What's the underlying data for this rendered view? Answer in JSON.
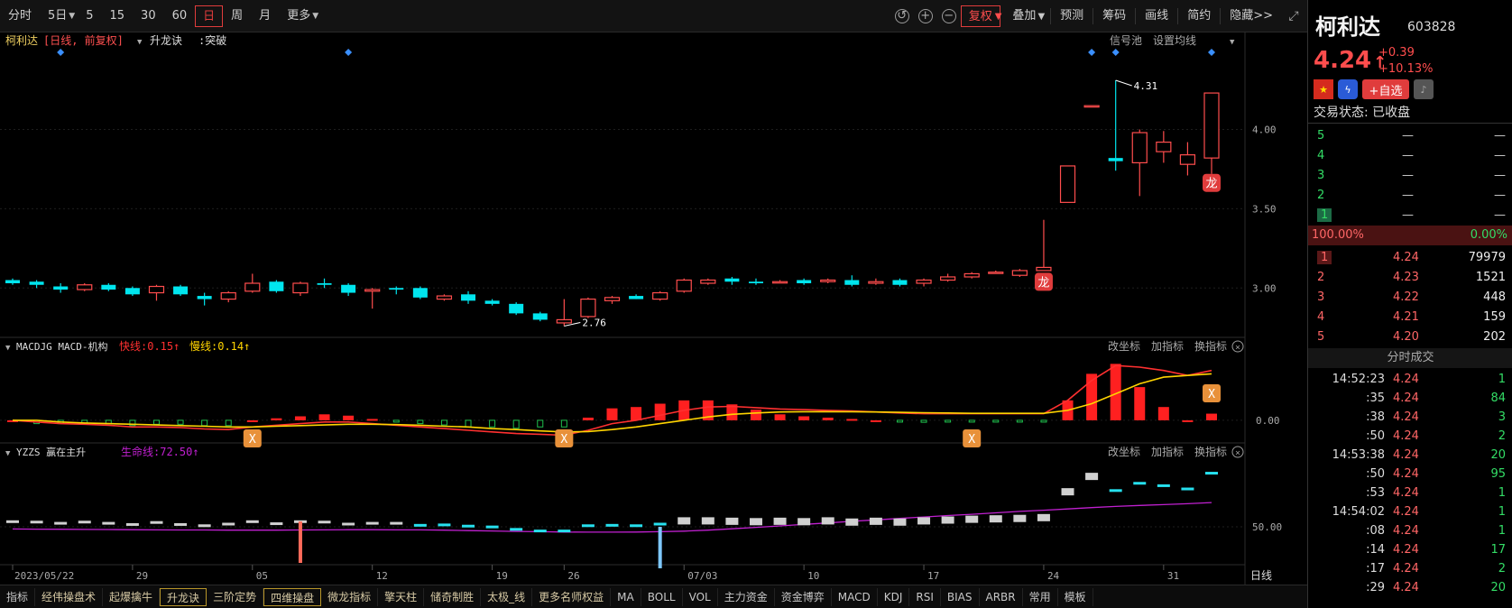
{
  "toolbar": {
    "left": [
      "分时",
      "5日",
      "5",
      "15",
      "30",
      "60",
      "日",
      "周",
      "月",
      "更多"
    ],
    "active_index": 6,
    "right": [
      "复权",
      "叠加",
      "预测",
      "筹码",
      "画线",
      "简约",
      "隐藏>>"
    ]
  },
  "stock": {
    "name": "柯利达",
    "code": "603828",
    "price": "4.24",
    "arrow": "↑",
    "change": "+0.39",
    "change_pct": "+10.13%",
    "trade_status": "交易状态: 已收盘",
    "add_fav": "+自选"
  },
  "main_panel": {
    "stock_label": "柯利达",
    "period_label": "[日线, 前复权]",
    "indicator": "升龙诀",
    "indicator_value": ":突破",
    "right_labels": [
      "信号池",
      "设置均线"
    ],
    "max_label": "4.31",
    "min_label": "2.76",
    "badge": "龙"
  },
  "macd_panel": {
    "name": "MACDJG MACD-机构",
    "fast_label": "快线:0.15↑",
    "slow_label": "慢线:0.14↑",
    "actions": [
      "改坐标",
      "加指标",
      "换指标"
    ],
    "badge": "X"
  },
  "yzzs_panel": {
    "name": "YZZS 赢在主升",
    "line_label": "生命线:72.50↑",
    "actions": [
      "改坐标",
      "加指标",
      "换指标"
    ]
  },
  "x_axis": {
    "labels": [
      "2023/05/22",
      "29",
      "05",
      "12",
      "19",
      "26",
      "07/03",
      "10",
      "17",
      "24",
      "31"
    ],
    "period": "日线"
  },
  "y_axis": {
    "main": [
      "4.00",
      "3.50",
      "3.00"
    ],
    "macd": [
      "0.00"
    ],
    "yzzs": [
      "50.00"
    ]
  },
  "bottom_tabs": [
    "指标",
    "经伟操盘术",
    "起爆擒牛",
    "升龙诀",
    "三阶定势",
    "四维操盘",
    "微龙指标",
    "擎天柱",
    "储奇制胜",
    "太极_线",
    "更多名师权益",
    "MA",
    "BOLL",
    "VOL",
    "主力资金",
    "资金博弈",
    "MACD",
    "KDJ",
    "RSI",
    "BIAS",
    "ARBR",
    "常用",
    "模板"
  ],
  "order_book": {
    "asks": [
      {
        "level": "5",
        "price": "—",
        "vol": "—"
      },
      {
        "level": "4",
        "price": "—",
        "vol": "—"
      },
      {
        "level": "3",
        "price": "—",
        "vol": "—"
      },
      {
        "level": "2",
        "price": "—",
        "vol": "—"
      },
      {
        "level": "1",
        "price": "—",
        "vol": "—"
      }
    ],
    "ratio_left": "100.00%",
    "ratio_right": "0.00%",
    "bids": [
      {
        "level": "1",
        "price": "4.24",
        "vol": "79979"
      },
      {
        "level": "2",
        "price": "4.23",
        "vol": "1521"
      },
      {
        "level": "3",
        "price": "4.22",
        "vol": "448"
      },
      {
        "level": "4",
        "price": "4.21",
        "vol": "159"
      },
      {
        "level": "5",
        "price": "4.20",
        "vol": "202"
      }
    ]
  },
  "ticks": {
    "title": "分时成交",
    "rows": [
      {
        "time": "14:52:23",
        "price": "4.24",
        "vol": "1"
      },
      {
        "time": ":35",
        "price": "4.24",
        "vol": "84"
      },
      {
        "time": ":38",
        "price": "4.24",
        "vol": "3"
      },
      {
        "time": ":50",
        "price": "4.24",
        "vol": "2"
      },
      {
        "time": "14:53:38",
        "price": "4.24",
        "vol": "20"
      },
      {
        "time": ":50",
        "price": "4.24",
        "vol": "95"
      },
      {
        "time": ":53",
        "price": "4.24",
        "vol": "1"
      },
      {
        "time": "14:54:02",
        "price": "4.24",
        "vol": "1"
      },
      {
        "time": ":08",
        "price": "4.24",
        "vol": "1"
      },
      {
        "time": ":14",
        "price": "4.24",
        "vol": "17"
      },
      {
        "time": ":17",
        "price": "4.24",
        "vol": "2"
      },
      {
        "time": ":29",
        "price": "4.24",
        "vol": "20"
      }
    ]
  },
  "colors": {
    "up": "#ff4d4d",
    "down": "#00e5ee",
    "macd_fast": "#ff3030",
    "macd_slow": "#ffd400",
    "life_line": "#c020d0",
    "accent": "#e03c3c"
  },
  "chart_data": {
    "type": "candlestick",
    "ylim": [
      2.7,
      4.35
    ],
    "candles": [
      {
        "date": "2023-05-22",
        "o": 3.05,
        "h": 3.06,
        "l": 3.02,
        "c": 3.03
      },
      {
        "date": "2023-05-23",
        "o": 3.04,
        "h": 3.05,
        "l": 3.0,
        "c": 3.02
      },
      {
        "date": "2023-05-24",
        "o": 3.01,
        "h": 3.03,
        "l": 2.97,
        "c": 2.99
      },
      {
        "date": "2023-05-25",
        "o": 2.99,
        "h": 3.03,
        "l": 2.98,
        "c": 3.02
      },
      {
        "date": "2023-05-26",
        "o": 3.02,
        "h": 3.03,
        "l": 2.98,
        "c": 2.99
      },
      {
        "date": "2023-05-29",
        "o": 3.0,
        "h": 3.01,
        "l": 2.95,
        "c": 2.96
      },
      {
        "date": "2023-05-30",
        "o": 2.97,
        "h": 3.02,
        "l": 2.92,
        "c": 3.01
      },
      {
        "date": "2023-05-31",
        "o": 3.01,
        "h": 3.02,
        "l": 2.95,
        "c": 2.96
      },
      {
        "date": "2023-06-01",
        "o": 2.95,
        "h": 2.97,
        "l": 2.89,
        "c": 2.93
      },
      {
        "date": "2023-06-02",
        "o": 2.93,
        "h": 2.98,
        "l": 2.91,
        "c": 2.97
      },
      {
        "date": "2023-06-05",
        "o": 2.98,
        "h": 3.09,
        "l": 2.97,
        "c": 3.03
      },
      {
        "date": "2023-06-06",
        "o": 3.04,
        "h": 3.05,
        "l": 2.97,
        "c": 2.98
      },
      {
        "date": "2023-06-07",
        "o": 2.97,
        "h": 3.04,
        "l": 2.95,
        "c": 3.03
      },
      {
        "date": "2023-06-08",
        "o": 3.03,
        "h": 3.06,
        "l": 3.0,
        "c": 3.02
      },
      {
        "date": "2023-06-09",
        "o": 3.02,
        "h": 3.03,
        "l": 2.95,
        "c": 2.97
      },
      {
        "date": "2023-06-12",
        "o": 2.98,
        "h": 3.0,
        "l": 2.87,
        "c": 2.99
      },
      {
        "date": "2023-06-13",
        "o": 3.0,
        "h": 3.01,
        "l": 2.96,
        "c": 2.99
      },
      {
        "date": "2023-06-14",
        "o": 3.0,
        "h": 3.01,
        "l": 2.93,
        "c": 2.94
      },
      {
        "date": "2023-06-15",
        "o": 2.93,
        "h": 2.96,
        "l": 2.92,
        "c": 2.95
      },
      {
        "date": "2023-06-16",
        "o": 2.96,
        "h": 2.98,
        "l": 2.9,
        "c": 2.92
      },
      {
        "date": "2023-06-19",
        "o": 2.92,
        "h": 2.93,
        "l": 2.89,
        "c": 2.9
      },
      {
        "date": "2023-06-20",
        "o": 2.9,
        "h": 2.91,
        "l": 2.83,
        "c": 2.84
      },
      {
        "date": "2023-06-21",
        "o": 2.84,
        "h": 2.85,
        "l": 2.79,
        "c": 2.8
      },
      {
        "date": "2023-06-26",
        "o": 2.78,
        "h": 2.93,
        "l": 2.76,
        "c": 2.8
      },
      {
        "date": "2023-06-27",
        "o": 2.82,
        "h": 2.94,
        "l": 2.81,
        "c": 2.93
      },
      {
        "date": "2023-06-28",
        "o": 2.92,
        "h": 2.95,
        "l": 2.9,
        "c": 2.94
      },
      {
        "date": "2023-06-29",
        "o": 2.95,
        "h": 2.96,
        "l": 2.93,
        "c": 2.93
      },
      {
        "date": "2023-06-30",
        "o": 2.93,
        "h": 2.98,
        "l": 2.92,
        "c": 2.97
      },
      {
        "date": "2023-07-03",
        "o": 2.98,
        "h": 3.06,
        "l": 2.97,
        "c": 3.05
      },
      {
        "date": "2023-07-04",
        "o": 3.03,
        "h": 3.06,
        "l": 3.02,
        "c": 3.05
      },
      {
        "date": "2023-07-05",
        "o": 3.06,
        "h": 3.07,
        "l": 3.02,
        "c": 3.04
      },
      {
        "date": "2023-07-06",
        "o": 3.04,
        "h": 3.06,
        "l": 3.02,
        "c": 3.03
      },
      {
        "date": "2023-07-07",
        "o": 3.04,
        "h": 3.05,
        "l": 3.04,
        "c": 3.04
      },
      {
        "date": "2023-07-10",
        "o": 3.05,
        "h": 3.06,
        "l": 3.02,
        "c": 3.03
      },
      {
        "date": "2023-07-11",
        "o": 3.04,
        "h": 3.06,
        "l": 3.03,
        "c": 3.05
      },
      {
        "date": "2023-07-12",
        "o": 3.05,
        "h": 3.08,
        "l": 3.01,
        "c": 3.02
      },
      {
        "date": "2023-07-13",
        "o": 3.03,
        "h": 3.06,
        "l": 3.02,
        "c": 3.04
      },
      {
        "date": "2023-07-14",
        "o": 3.05,
        "h": 3.06,
        "l": 3.01,
        "c": 3.02
      },
      {
        "date": "2023-07-17",
        "o": 3.03,
        "h": 3.06,
        "l": 3.01,
        "c": 3.05
      },
      {
        "date": "2023-07-18",
        "o": 3.05,
        "h": 3.09,
        "l": 3.04,
        "c": 3.07
      },
      {
        "date": "2023-07-19",
        "o": 3.07,
        "h": 3.1,
        "l": 3.06,
        "c": 3.09
      },
      {
        "date": "2023-07-20",
        "o": 3.1,
        "h": 3.11,
        "l": 3.09,
        "c": 3.1
      },
      {
        "date": "2023-07-21",
        "o": 3.08,
        "h": 3.12,
        "l": 3.07,
        "c": 3.11
      },
      {
        "date": "2023-07-24",
        "o": 3.11,
        "h": 3.43,
        "l": 3.11,
        "c": 3.13
      },
      {
        "date": "2023-07-25",
        "o": 3.54,
        "h": 3.77,
        "l": 3.54,
        "c": 3.77
      },
      {
        "date": "2023-07-26",
        "o": 4.15,
        "h": 4.15,
        "l": 4.15,
        "c": 4.15
      },
      {
        "date": "2023-07-27",
        "o": 3.82,
        "h": 4.31,
        "l": 3.74,
        "c": 3.8
      },
      {
        "date": "2023-07-28",
        "o": 3.79,
        "h": 4.0,
        "l": 3.58,
        "c": 3.98
      },
      {
        "date": "2023-07-31",
        "o": 3.86,
        "h": 3.99,
        "l": 3.79,
        "c": 3.92
      },
      {
        "date": "2023-08-01",
        "o": 3.78,
        "h": 3.92,
        "l": 3.71,
        "c": 3.84
      },
      {
        "date": "2023-08-02",
        "o": 3.82,
        "h": 4.11,
        "l": 3.72,
        "c": 4.23
      }
    ],
    "macd_fast": [
      0.0,
      -0.005,
      -0.01,
      -0.012,
      -0.015,
      -0.02,
      -0.02,
      -0.022,
      -0.026,
      -0.028,
      -0.02,
      -0.015,
      -0.01,
      -0.005,
      -0.005,
      -0.01,
      -0.015,
      -0.02,
      -0.025,
      -0.03,
      -0.035,
      -0.04,
      -0.042,
      -0.045,
      -0.03,
      -0.01,
      0.0,
      0.015,
      0.03,
      0.04,
      0.042,
      0.038,
      0.034,
      0.032,
      0.03,
      0.028,
      0.025,
      0.022,
      0.02,
      0.02,
      0.02,
      0.02,
      0.02,
      0.02,
      0.06,
      0.12,
      0.165,
      0.16,
      0.15,
      0.135,
      0.15
    ],
    "macd_slow": [
      0.0,
      0.0,
      -0.005,
      -0.008,
      -0.01,
      -0.012,
      -0.014,
      -0.016,
      -0.018,
      -0.02,
      -0.02,
      -0.018,
      -0.016,
      -0.014,
      -0.012,
      -0.012,
      -0.013,
      -0.015,
      -0.018,
      -0.02,
      -0.025,
      -0.028,
      -0.032,
      -0.035,
      -0.034,
      -0.028,
      -0.02,
      -0.01,
      0.0,
      0.01,
      0.018,
      0.022,
      0.025,
      0.026,
      0.026,
      0.026,
      0.025,
      0.024,
      0.023,
      0.022,
      0.021,
      0.021,
      0.021,
      0.021,
      0.03,
      0.05,
      0.08,
      0.11,
      0.13,
      0.135,
      0.14
    ],
    "yzzs_line": [
      48.5,
      48.4,
      48.3,
      48.2,
      48.1,
      48.0,
      47.9,
      47.8,
      47.8,
      47.7,
      47.7,
      47.7,
      47.8,
      47.9,
      48.0,
      48.0,
      47.9,
      47.9,
      47.7,
      47.4,
      47.1,
      46.8,
      46.6,
      46.4,
      46.3,
      46.3,
      46.4,
      46.6,
      47.0,
      47.7,
      48.6,
      49.6,
      50.6,
      51.7,
      52.7,
      53.8,
      54.8,
      55.8,
      56.8,
      57.8,
      58.7,
      59.7,
      60.7,
      61.5,
      62.4,
      63.3,
      64.1,
      64.8,
      65.4,
      66.0,
      66.8
    ]
  }
}
